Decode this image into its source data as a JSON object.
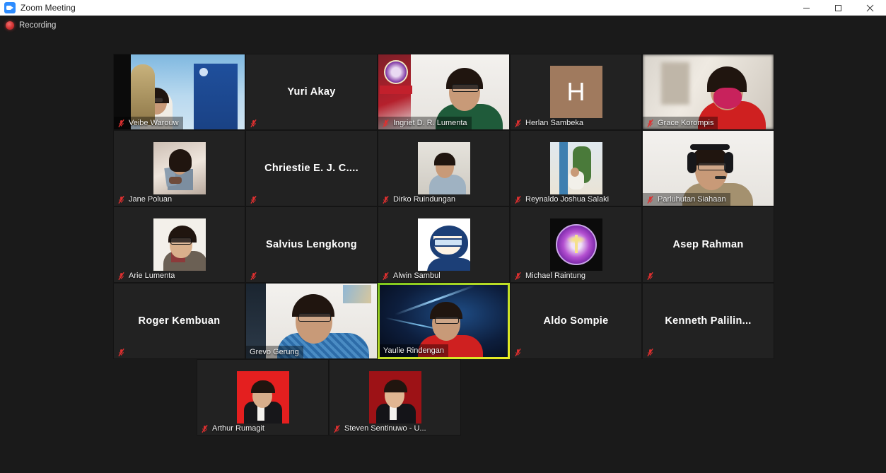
{
  "window": {
    "title": "Zoom Meeting",
    "app_icon": "zoom-icon",
    "controls": {
      "minimize": "minimize-icon",
      "maximize": "maximize-icon",
      "close": "close-icon"
    }
  },
  "status": {
    "recording_label": "Recording",
    "recording_icon": "recording-dot-icon"
  },
  "colors": {
    "active_speaker_border": "#c9e02b",
    "tile_background": "#222222",
    "meeting_background": "#1a1a1a",
    "recording_dot": "#d03232",
    "muted_mic": "#e03030",
    "titlebar_background": "#ffffff",
    "avatar_letter_background": "#a07a5e"
  },
  "meeting": {
    "layout": "gallery-grid",
    "columns": 5,
    "rows": 5,
    "total_participants": 22,
    "rows_data": [
      {
        "tiles": [
          {
            "name": "Veibe Warouw",
            "type": "video",
            "muted": true,
            "active_speaker": false,
            "name_shaded": true,
            "art": "veibe"
          },
          {
            "name": "Yuri Akay",
            "type": "name-only",
            "muted": true,
            "active_speaker": false,
            "name_shaded": false,
            "art": ""
          },
          {
            "name": "Ingriet D. R. Lumenta",
            "type": "video",
            "muted": true,
            "active_speaker": false,
            "name_shaded": true,
            "art": "ingriet"
          },
          {
            "name": "Herlan Sambeka",
            "type": "letter-avatar",
            "initial": "H",
            "muted": true,
            "active_speaker": false,
            "name_shaded": false,
            "art": ""
          },
          {
            "name": "Grace Korompis",
            "type": "video",
            "muted": true,
            "active_speaker": false,
            "name_shaded": true,
            "art": "grace"
          }
        ]
      },
      {
        "tiles": [
          {
            "name": "Jane Poluan",
            "type": "photo-avatar",
            "muted": true,
            "active_speaker": false,
            "name_shaded": false,
            "art": "jane"
          },
          {
            "name": "Chriestie E. J. C....",
            "type": "name-only",
            "muted": true,
            "active_speaker": false,
            "name_shaded": false,
            "art": ""
          },
          {
            "name": "Dirko Ruindungan",
            "type": "photo-avatar",
            "muted": true,
            "active_speaker": false,
            "name_shaded": false,
            "art": "dirko"
          },
          {
            "name": "Reynaldo Joshua Salaki",
            "type": "photo-avatar",
            "muted": true,
            "active_speaker": false,
            "name_shaded": false,
            "art": "reynaldo"
          },
          {
            "name": "Parluhutan Siahaan",
            "type": "video",
            "muted": true,
            "active_speaker": false,
            "name_shaded": true,
            "art": "parluhutan"
          }
        ]
      },
      {
        "tiles": [
          {
            "name": "Arie Lumenta",
            "type": "photo-avatar",
            "muted": true,
            "active_speaker": false,
            "name_shaded": false,
            "art": "arie"
          },
          {
            "name": "Salvius Lengkong",
            "type": "name-only",
            "muted": true,
            "active_speaker": false,
            "name_shaded": false,
            "art": ""
          },
          {
            "name": "Alwin Sambul",
            "type": "photo-avatar",
            "muted": true,
            "active_speaker": false,
            "name_shaded": false,
            "art": "alwin"
          },
          {
            "name": "Michael Raintung",
            "type": "photo-avatar",
            "muted": true,
            "active_speaker": false,
            "name_shaded": false,
            "art": "michael"
          },
          {
            "name": "Asep Rahman",
            "type": "name-only",
            "muted": true,
            "active_speaker": false,
            "name_shaded": false,
            "art": ""
          }
        ]
      },
      {
        "tiles": [
          {
            "name": "Roger Kembuan",
            "type": "name-only",
            "muted": true,
            "active_speaker": false,
            "name_shaded": false,
            "art": ""
          },
          {
            "name": "Grevo Gerung",
            "type": "video",
            "muted": false,
            "active_speaker": false,
            "name_shaded": true,
            "art": "grevo"
          },
          {
            "name": "Yaulie Rindengan",
            "type": "video",
            "muted": false,
            "active_speaker": true,
            "name_shaded": true,
            "art": "yaulie"
          },
          {
            "name": "Aldo Sompie",
            "type": "name-only",
            "muted": true,
            "active_speaker": false,
            "name_shaded": false,
            "art": ""
          },
          {
            "name": "Kenneth  Palilin...",
            "type": "name-only",
            "muted": true,
            "active_speaker": false,
            "name_shaded": false,
            "art": ""
          }
        ]
      },
      {
        "tiles": [
          {
            "name": "Arthur Rumagit",
            "type": "photo-avatar",
            "muted": true,
            "active_speaker": false,
            "name_shaded": false,
            "art": "arthur"
          },
          {
            "name": "Steven Sentinuwo - U...",
            "type": "photo-avatar",
            "muted": true,
            "active_speaker": false,
            "name_shaded": false,
            "art": "steven"
          }
        ]
      }
    ]
  }
}
